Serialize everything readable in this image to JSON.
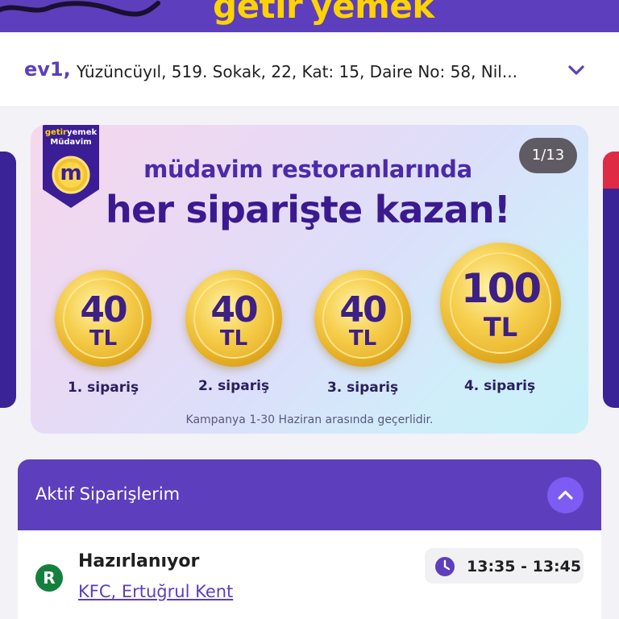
{
  "header": {
    "logo_getir": "getir",
    "logo_yemek": "yemek"
  },
  "address": {
    "label": "ev1,",
    "text": "Yüzüncüyıl, 519. Sokak, 22, Kat: 15, Daire No: 58, Nil...",
    "toggle_icon": "chevron-down-icon"
  },
  "banner": {
    "badge_brand_getir": "getir",
    "badge_brand_yemek": "yemek",
    "badge_name": "Müdavim",
    "badge_letter": "m",
    "counter": "1/13",
    "headline_1": "müdavim restoranlarında",
    "headline_2": "her siparişte kazan!",
    "coins": [
      {
        "amount": "40",
        "unit": "TL",
        "caption": "1. sipariş"
      },
      {
        "amount": "40",
        "unit": "TL",
        "caption": "2. sipariş"
      },
      {
        "amount": "40",
        "unit": "TL",
        "caption": "3. sipariş"
      },
      {
        "amount": "100",
        "unit": "TL",
        "caption": "4. sipariş"
      }
    ],
    "note": "Kampanya 1-30 Haziran arasında geçerlidir."
  },
  "orders": {
    "title": "Aktif Siparişlerim",
    "collapse_icon": "chevron-up-icon",
    "items": [
      {
        "badge": "R",
        "status": "Hazırlanıyor",
        "restaurant": "KFC, Ertuğrul Kent",
        "time": "13:35 - 13:45",
        "time_icon": "clock-icon"
      }
    ]
  },
  "colors": {
    "brand_purple": "#5d3ebc",
    "brand_yellow": "#ffd300",
    "status_green": "#15803d",
    "accent_violet": "#7c5cf2"
  }
}
